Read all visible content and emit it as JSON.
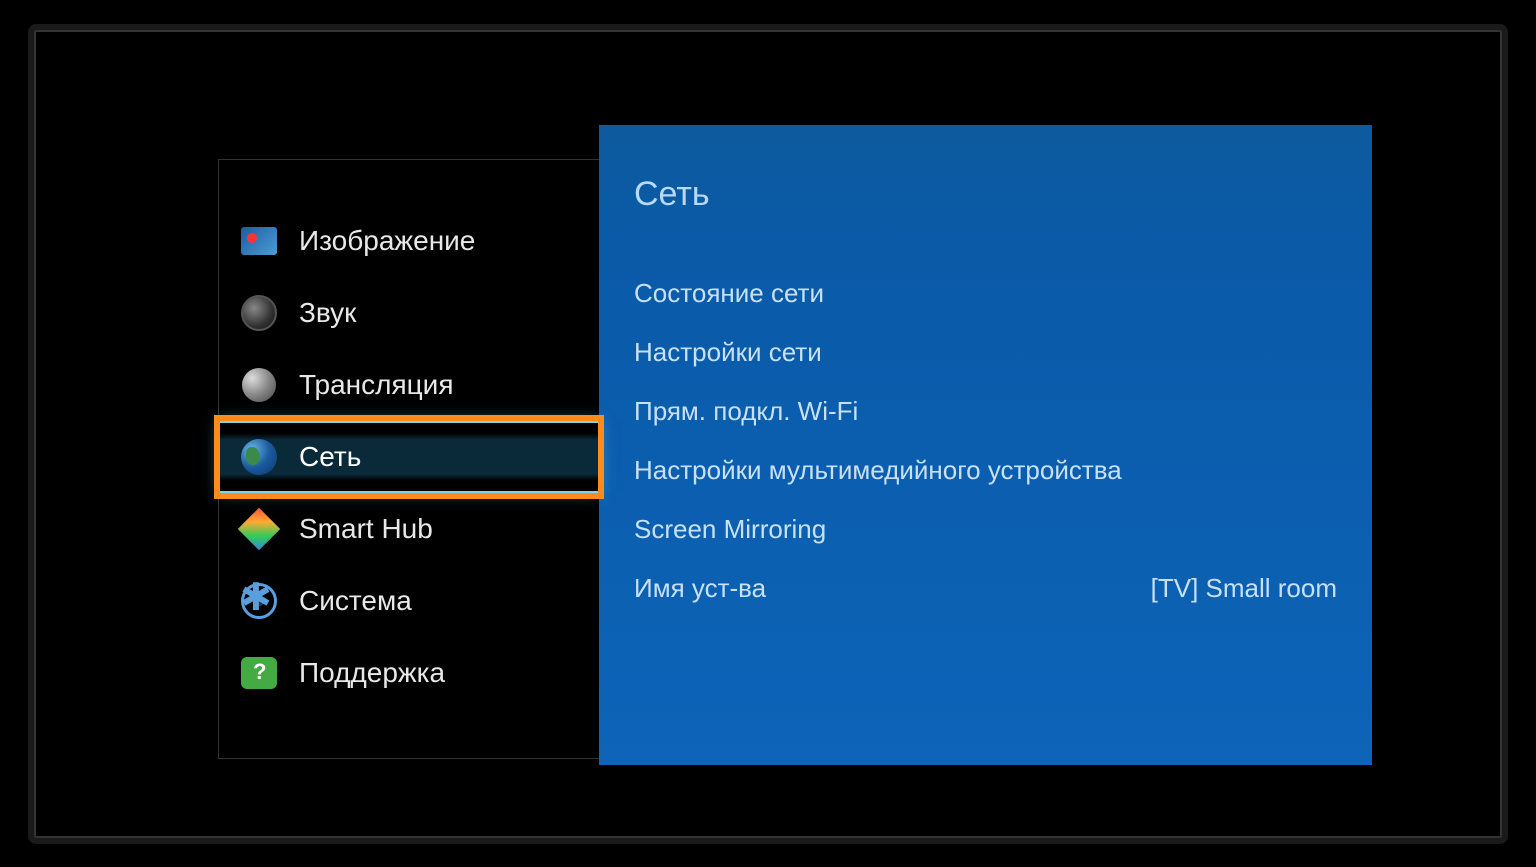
{
  "sidebar": {
    "items": [
      {
        "label": "Изображение",
        "icon": "picture",
        "selected": false
      },
      {
        "label": "Звук",
        "icon": "sound",
        "selected": false
      },
      {
        "label": "Трансляция",
        "icon": "broadcast",
        "selected": false
      },
      {
        "label": "Сеть",
        "icon": "network",
        "selected": true
      },
      {
        "label": "Smart Hub",
        "icon": "smarthub",
        "selected": false
      },
      {
        "label": "Система",
        "icon": "system",
        "selected": false
      },
      {
        "label": "Поддержка",
        "icon": "support",
        "selected": false
      }
    ]
  },
  "content": {
    "title": "Сеть",
    "items": [
      {
        "label": "Состояние сети",
        "value": ""
      },
      {
        "label": "Настройки сети",
        "value": ""
      },
      {
        "label": "Прям. подкл. Wi-Fi",
        "value": ""
      },
      {
        "label": "Настройки мультимедийного устройства",
        "value": ""
      },
      {
        "label": "Screen Mirroring",
        "value": ""
      },
      {
        "label": "Имя уст-ва",
        "value": "[TV] Small room"
      }
    ]
  }
}
